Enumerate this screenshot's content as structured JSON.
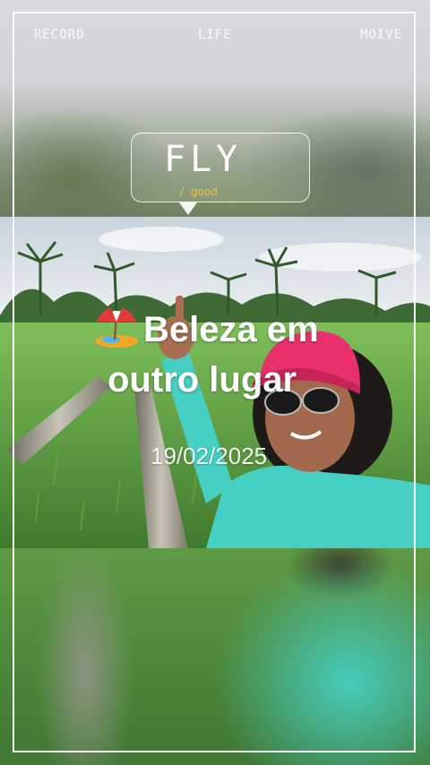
{
  "labels": {
    "left": "RECORD",
    "center": "LIFE",
    "right": "MOIVE"
  },
  "bubble": {
    "title": "FLY",
    "separator": "/",
    "subtitle": "good"
  },
  "caption": {
    "line1": "Beleza em",
    "line2": "outro lugar",
    "icon": "beach-umbrella-icon"
  },
  "date": "19/02/2025",
  "colors": {
    "frame": "#ffffff",
    "accent": "#f2c23e",
    "shirt": "#46d0c4",
    "cap": "#e8306a"
  }
}
